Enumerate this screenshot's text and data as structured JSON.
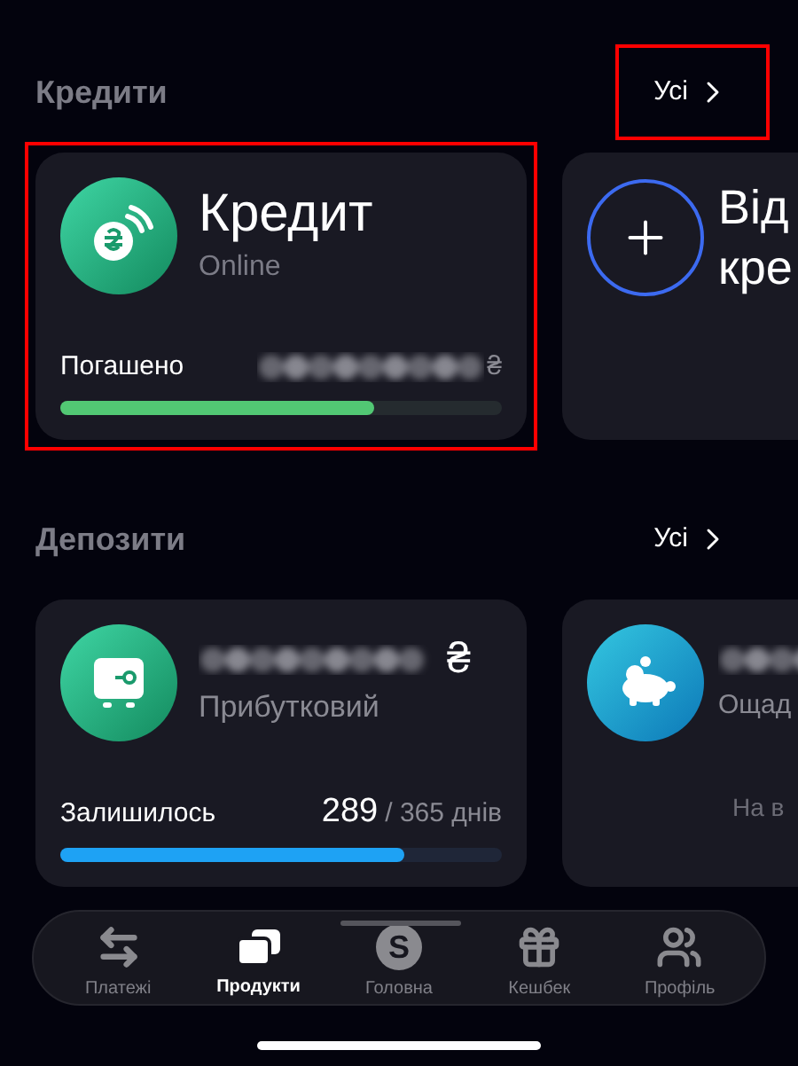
{
  "sections": [
    {
      "title": "Кредити",
      "all_link": {
        "label": "Усі",
        "highlighted": true
      },
      "cards": [
        {
          "kind": "credit",
          "highlighted": true,
          "title": "Кредит",
          "subtitle": "Online",
          "progress_label": "Погашено",
          "currency": "₴",
          "level": 0.71
        },
        {
          "kind": "new",
          "lines": [
            "Від",
            "кре"
          ]
        }
      ]
    },
    {
      "title": "Депозити",
      "all_link": {
        "label": "Усі",
        "highlighted": false
      },
      "cards": [
        {
          "kind": "deposit",
          "currency": "₴",
          "subtitle": "Прибутковий",
          "progress_label": "Залишилось",
          "count": "289",
          "total": "/ 365 днів",
          "level": 0.78
        },
        {
          "kind": "savings",
          "subtitle": "Ощад",
          "note": "На в"
        }
      ]
    }
  ],
  "nav": [
    {
      "kind": "transfer",
      "label": "Платежі",
      "selected": false
    },
    {
      "kind": "products",
      "label": "Продукти",
      "selected": true
    },
    {
      "kind": "home",
      "label": "Головна",
      "glyph": "S",
      "selected": false
    },
    {
      "kind": "gift",
      "label": "Кешбек",
      "selected": false
    },
    {
      "kind": "people",
      "label": "Профіль",
      "selected": false
    }
  ]
}
